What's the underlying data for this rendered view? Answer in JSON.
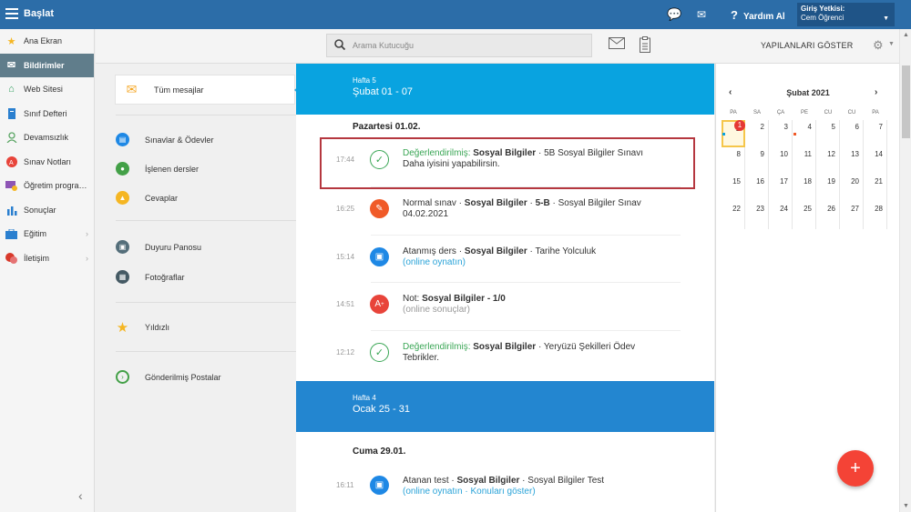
{
  "topbar": {
    "title": "Başlat",
    "help": "Yardım Al",
    "user_label": "Giriş Yetkisi:",
    "user_name": "Cem Öğrenci"
  },
  "sidebar": {
    "items": [
      {
        "label": "Ana Ekran",
        "icon": "star-icon",
        "color": "#f5b623"
      },
      {
        "label": "Bildirimler",
        "icon": "envelope-icon",
        "color": "#ffffff"
      },
      {
        "label": "Web Sitesi",
        "icon": "home-icon",
        "color": "#2e9e5b"
      },
      {
        "label": "Sınıf Defteri",
        "icon": "notebook-icon",
        "color": "#2a7fcf"
      },
      {
        "label": "Devamsızlık",
        "icon": "person-icon",
        "color": "#5aa564"
      },
      {
        "label": "Sınav Notları",
        "icon": "grade-icon",
        "color": "#e8443a"
      },
      {
        "label": "Öğretim progra…",
        "icon": "program-icon",
        "color": "#8e55b5"
      },
      {
        "label": "Sonuçlar",
        "icon": "bar-chart-icon",
        "color": "#2a7fcf"
      },
      {
        "label": "Eğitim",
        "icon": "briefcase-icon",
        "color": "#2a7fcf"
      },
      {
        "label": "İletişim",
        "icon": "chat-icon",
        "color": "#d8392b"
      }
    ]
  },
  "subbar": {
    "search_placeholder": "Arama Kutucuğu",
    "show_done": "YAPILANLARI GÖSTER"
  },
  "folders": [
    {
      "label": "Tüm mesajlar",
      "icon": "envelope-icon",
      "color": "#f5a623"
    },
    {
      "label": "Sınavlar & Ödevler",
      "icon": "exam-icon",
      "color": "#1e88e5"
    },
    {
      "label": "İşlenen dersler",
      "icon": "lesson-icon",
      "color": "#43a047"
    },
    {
      "label": "Cevaplar",
      "icon": "answer-icon",
      "color": "#f5b623"
    },
    {
      "label": "Duyuru Panosu",
      "icon": "board-icon",
      "color": "#546e7a"
    },
    {
      "label": "Fotoğraflar",
      "icon": "photo-icon",
      "color": "#455a64"
    },
    {
      "label": "Yıldızlı",
      "icon": "star-icon",
      "color": "#f5b623"
    },
    {
      "label": "Gönderilmiş Postalar",
      "icon": "sent-icon",
      "color": "#43a047"
    }
  ],
  "feed": {
    "week1": {
      "label": "Hafta 5",
      "range": "Şubat 01 - 07",
      "color": "#09a3e0"
    },
    "day1": "Pazartesi 01.02.",
    "messages": [
      {
        "time": "17:44",
        "status": "Değerlendirilmiş:",
        "subject": "Sosyal Bilgiler",
        "sep": " · ",
        "rest": "5B Sosyal Bilgiler Sınavı",
        "line2": "Daha iyisini yapabilirsin."
      },
      {
        "time": "16:25",
        "prefix": "Normal sınav",
        "subject": "Sosyal Bilgiler",
        "cls": "5-B",
        "rest": "Sosyal Bilgiler Sınav",
        "line2": "04.02.2021"
      },
      {
        "time": "15:14",
        "prefix": "Atanmış ders",
        "subject": "Sosyal Bilgiler",
        "rest": "Tarihe Yolculuk",
        "link": "(online oynatın)"
      },
      {
        "time": "14:51",
        "prefix": "Not:",
        "subject": "Sosyal Bilgiler - 1/0",
        "line2": "(online sonuçlar)"
      },
      {
        "time": "12:12",
        "status": "Değerlendirilmiş:",
        "subject": "Sosyal Bilgiler",
        "rest": "Yeryüzü Şekilleri Ödev",
        "line2": "Tebrikler."
      }
    ],
    "week2": {
      "label": "Hafta 4",
      "range": "Ocak 25 - 31",
      "color": "#2386d0"
    },
    "day2": "Cuma 29.01.",
    "message6": {
      "time": "16:11",
      "prefix": "Atanan test",
      "subject": "Sosyal Bilgiler",
      "rest": "Sosyal Bilgiler Test",
      "link1": "(online oynatın",
      "link_sep": " · ",
      "link2": "Konuları göster)"
    }
  },
  "calendar": {
    "month": "Şubat 2021",
    "dow": [
      "PA",
      "SA",
      "ÇA",
      "PE",
      "CU",
      "CU",
      "PA"
    ],
    "days": [
      "1",
      "2",
      "3",
      "4",
      "5",
      "6",
      "7",
      "8",
      "9",
      "10",
      "11",
      "12",
      "13",
      "14",
      "15",
      "16",
      "17",
      "18",
      "19",
      "20",
      "21",
      "22",
      "23",
      "24",
      "25",
      "26",
      "27",
      "28"
    ],
    "badge": "1"
  },
  "fab": "+"
}
